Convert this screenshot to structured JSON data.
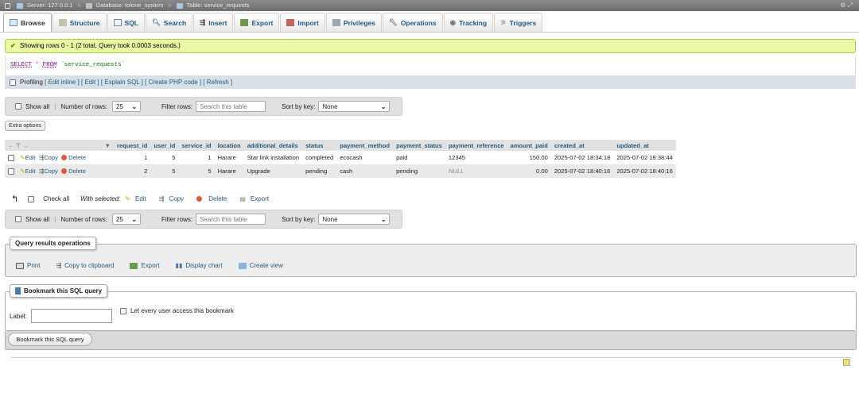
{
  "breadcrumb": {
    "server": "Server: 127.0.0.1",
    "database": "Database: tolone_system",
    "table": "Table: service_requests"
  },
  "tabs": [
    "Browse",
    "Structure",
    "SQL",
    "Search",
    "Insert",
    "Export",
    "Import",
    "Privileges",
    "Operations",
    "Tracking",
    "Triggers"
  ],
  "message": "Showing rows 0 - 1 (2 total, Query took 0.0003 seconds.)",
  "sql": {
    "select": "SELECT",
    "star": "*",
    "from": "FROM",
    "table": "`service_requests`"
  },
  "profiling": {
    "label": "Profiling",
    "links": "[ Edit inline ] [ Edit ] [ Explain SQL ] [ Create PHP code ] [ Refresh ]"
  },
  "nav": {
    "show_all": "Show all",
    "rows_label": "Number of rows:",
    "rows_value": "25",
    "filter_label": "Filter rows:",
    "filter_placeholder": "Search this table",
    "sort_label": "Sort by key:",
    "sort_value": "None"
  },
  "extra_options": "Extra options",
  "table": {
    "headers": [
      "request_id",
      "user_id",
      "service_id",
      "location",
      "additional_details",
      "status",
      "payment_method",
      "payment_status",
      "payment_reference",
      "amount_paid",
      "created_at",
      "updated_at"
    ],
    "actions": {
      "edit": "Edit",
      "copy": "Copy",
      "delete": "Delete"
    },
    "rows": [
      [
        "1",
        "5",
        "1",
        "Harare",
        "Star link installation",
        "completed",
        "ecocash",
        "paid",
        "12345",
        "150.00",
        "2025-07-02 18:34:18",
        "2025-07-02 18:38:44"
      ],
      [
        "2",
        "5",
        "5",
        "Harare",
        "Upgrade",
        "pending",
        "cash",
        "pending",
        "NULL",
        "0.00",
        "2025-07-02 18:40:16",
        "2025-07-02 18:40:16"
      ]
    ]
  },
  "with_selected": {
    "check_all": "Check all",
    "label": "With selected:",
    "edit": "Edit",
    "copy": "Copy",
    "delete": "Delete",
    "export": "Export"
  },
  "query_ops": {
    "legend": "Query results operations",
    "items": [
      "Print",
      "Copy to clipboard",
      "Export",
      "Display chart",
      "Create view"
    ]
  },
  "bookmark": {
    "legend": "Bookmark this SQL query",
    "label": "Label:",
    "share": "Let every user access this bookmark",
    "button": "Bookmark this SQL query"
  }
}
